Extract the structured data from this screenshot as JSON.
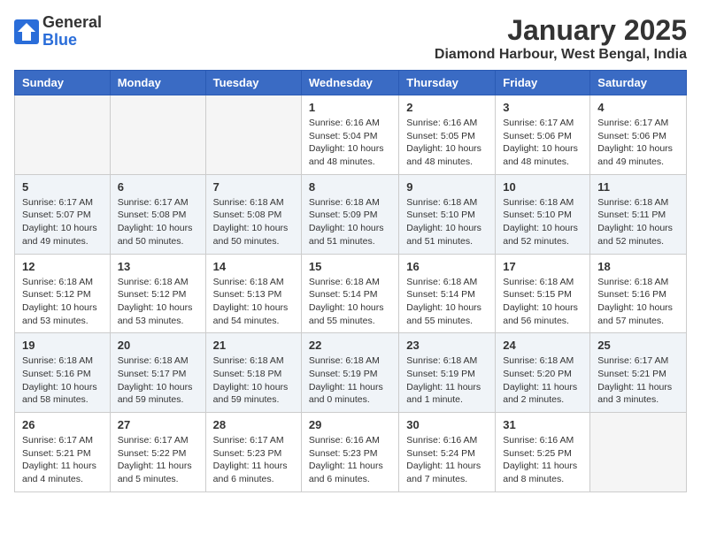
{
  "logo": {
    "general": "General",
    "blue": "Blue"
  },
  "header": {
    "month": "January 2025",
    "location": "Diamond Harbour, West Bengal, India"
  },
  "weekdays": [
    "Sunday",
    "Monday",
    "Tuesday",
    "Wednesday",
    "Thursday",
    "Friday",
    "Saturday"
  ],
  "weeks": [
    [
      {
        "day": "",
        "info": ""
      },
      {
        "day": "",
        "info": ""
      },
      {
        "day": "",
        "info": ""
      },
      {
        "day": "1",
        "info": "Sunrise: 6:16 AM\nSunset: 5:04 PM\nDaylight: 10 hours\nand 48 minutes."
      },
      {
        "day": "2",
        "info": "Sunrise: 6:16 AM\nSunset: 5:05 PM\nDaylight: 10 hours\nand 48 minutes."
      },
      {
        "day": "3",
        "info": "Sunrise: 6:17 AM\nSunset: 5:06 PM\nDaylight: 10 hours\nand 48 minutes."
      },
      {
        "day": "4",
        "info": "Sunrise: 6:17 AM\nSunset: 5:06 PM\nDaylight: 10 hours\nand 49 minutes."
      }
    ],
    [
      {
        "day": "5",
        "info": "Sunrise: 6:17 AM\nSunset: 5:07 PM\nDaylight: 10 hours\nand 49 minutes."
      },
      {
        "day": "6",
        "info": "Sunrise: 6:17 AM\nSunset: 5:08 PM\nDaylight: 10 hours\nand 50 minutes."
      },
      {
        "day": "7",
        "info": "Sunrise: 6:18 AM\nSunset: 5:08 PM\nDaylight: 10 hours\nand 50 minutes."
      },
      {
        "day": "8",
        "info": "Sunrise: 6:18 AM\nSunset: 5:09 PM\nDaylight: 10 hours\nand 51 minutes."
      },
      {
        "day": "9",
        "info": "Sunrise: 6:18 AM\nSunset: 5:10 PM\nDaylight: 10 hours\nand 51 minutes."
      },
      {
        "day": "10",
        "info": "Sunrise: 6:18 AM\nSunset: 5:10 PM\nDaylight: 10 hours\nand 52 minutes."
      },
      {
        "day": "11",
        "info": "Sunrise: 6:18 AM\nSunset: 5:11 PM\nDaylight: 10 hours\nand 52 minutes."
      }
    ],
    [
      {
        "day": "12",
        "info": "Sunrise: 6:18 AM\nSunset: 5:12 PM\nDaylight: 10 hours\nand 53 minutes."
      },
      {
        "day": "13",
        "info": "Sunrise: 6:18 AM\nSunset: 5:12 PM\nDaylight: 10 hours\nand 53 minutes."
      },
      {
        "day": "14",
        "info": "Sunrise: 6:18 AM\nSunset: 5:13 PM\nDaylight: 10 hours\nand 54 minutes."
      },
      {
        "day": "15",
        "info": "Sunrise: 6:18 AM\nSunset: 5:14 PM\nDaylight: 10 hours\nand 55 minutes."
      },
      {
        "day": "16",
        "info": "Sunrise: 6:18 AM\nSunset: 5:14 PM\nDaylight: 10 hours\nand 55 minutes."
      },
      {
        "day": "17",
        "info": "Sunrise: 6:18 AM\nSunset: 5:15 PM\nDaylight: 10 hours\nand 56 minutes."
      },
      {
        "day": "18",
        "info": "Sunrise: 6:18 AM\nSunset: 5:16 PM\nDaylight: 10 hours\nand 57 minutes."
      }
    ],
    [
      {
        "day": "19",
        "info": "Sunrise: 6:18 AM\nSunset: 5:16 PM\nDaylight: 10 hours\nand 58 minutes."
      },
      {
        "day": "20",
        "info": "Sunrise: 6:18 AM\nSunset: 5:17 PM\nDaylight: 10 hours\nand 59 minutes."
      },
      {
        "day": "21",
        "info": "Sunrise: 6:18 AM\nSunset: 5:18 PM\nDaylight: 10 hours\nand 59 minutes."
      },
      {
        "day": "22",
        "info": "Sunrise: 6:18 AM\nSunset: 5:19 PM\nDaylight: 11 hours\nand 0 minutes."
      },
      {
        "day": "23",
        "info": "Sunrise: 6:18 AM\nSunset: 5:19 PM\nDaylight: 11 hours\nand 1 minute."
      },
      {
        "day": "24",
        "info": "Sunrise: 6:18 AM\nSunset: 5:20 PM\nDaylight: 11 hours\nand 2 minutes."
      },
      {
        "day": "25",
        "info": "Sunrise: 6:17 AM\nSunset: 5:21 PM\nDaylight: 11 hours\nand 3 minutes."
      }
    ],
    [
      {
        "day": "26",
        "info": "Sunrise: 6:17 AM\nSunset: 5:21 PM\nDaylight: 11 hours\nand 4 minutes."
      },
      {
        "day": "27",
        "info": "Sunrise: 6:17 AM\nSunset: 5:22 PM\nDaylight: 11 hours\nand 5 minutes."
      },
      {
        "day": "28",
        "info": "Sunrise: 6:17 AM\nSunset: 5:23 PM\nDaylight: 11 hours\nand 6 minutes."
      },
      {
        "day": "29",
        "info": "Sunrise: 6:16 AM\nSunset: 5:23 PM\nDaylight: 11 hours\nand 6 minutes."
      },
      {
        "day": "30",
        "info": "Sunrise: 6:16 AM\nSunset: 5:24 PM\nDaylight: 11 hours\nand 7 minutes."
      },
      {
        "day": "31",
        "info": "Sunrise: 6:16 AM\nSunset: 5:25 PM\nDaylight: 11 hours\nand 8 minutes."
      },
      {
        "day": "",
        "info": ""
      }
    ]
  ]
}
